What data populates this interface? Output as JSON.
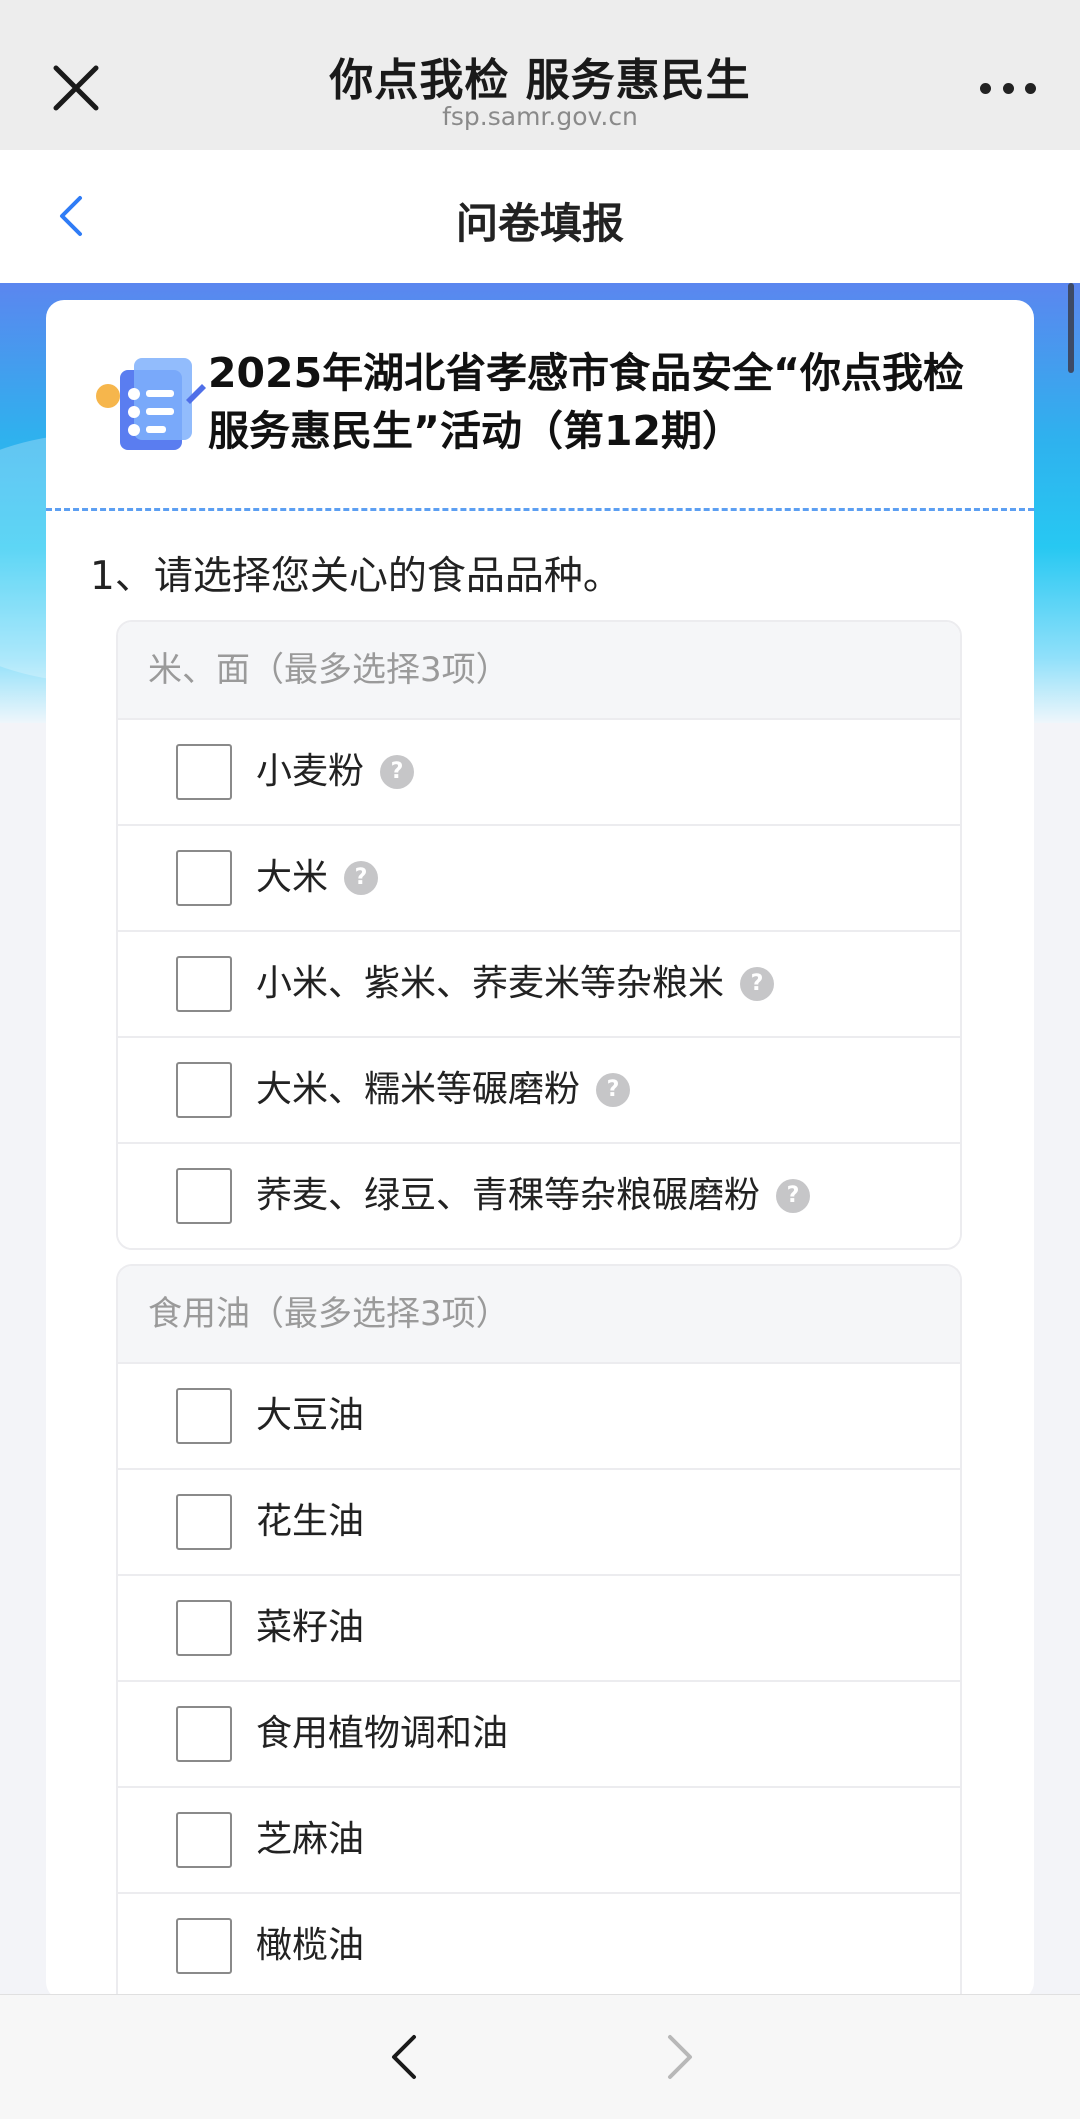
{
  "browser": {
    "title": "你点我检 服务惠民生",
    "url": "fsp.samr.gov.cn"
  },
  "header": {
    "title": "问卷填报"
  },
  "survey": {
    "title": "2025年湖北省孝感市食品安全“你点我检 服务惠民生”活动（第12期）",
    "question": "1、请选择您关心的食品品种。",
    "groups": [
      {
        "title": "米、面（最多选择3项）",
        "options": [
          {
            "label": "小麦粉",
            "help": true
          },
          {
            "label": "大米",
            "help": true
          },
          {
            "label": "小米、紫米、荞麦米等杂粮米",
            "help": true
          },
          {
            "label": "大米、糯米等碾磨粉",
            "help": true
          },
          {
            "label": "荞麦、绿豆、青稞等杂粮碾磨粉",
            "help": true
          }
        ]
      },
      {
        "title": "食用油（最多选择3项）",
        "options": [
          {
            "label": "大豆油",
            "help": false
          },
          {
            "label": "花生油",
            "help": false
          },
          {
            "label": "菜籽油",
            "help": false
          },
          {
            "label": "食用植物调和油",
            "help": false
          },
          {
            "label": "芝麻油",
            "help": false
          },
          {
            "label": "橄榄油",
            "help": false
          }
        ]
      }
    ]
  },
  "help_glyph": "?",
  "colors": {
    "accent": "#2f7cf6",
    "banner_top": "#5b86ef",
    "banner_mid": "#27c8f2",
    "dashed": "#5c9ff2"
  }
}
